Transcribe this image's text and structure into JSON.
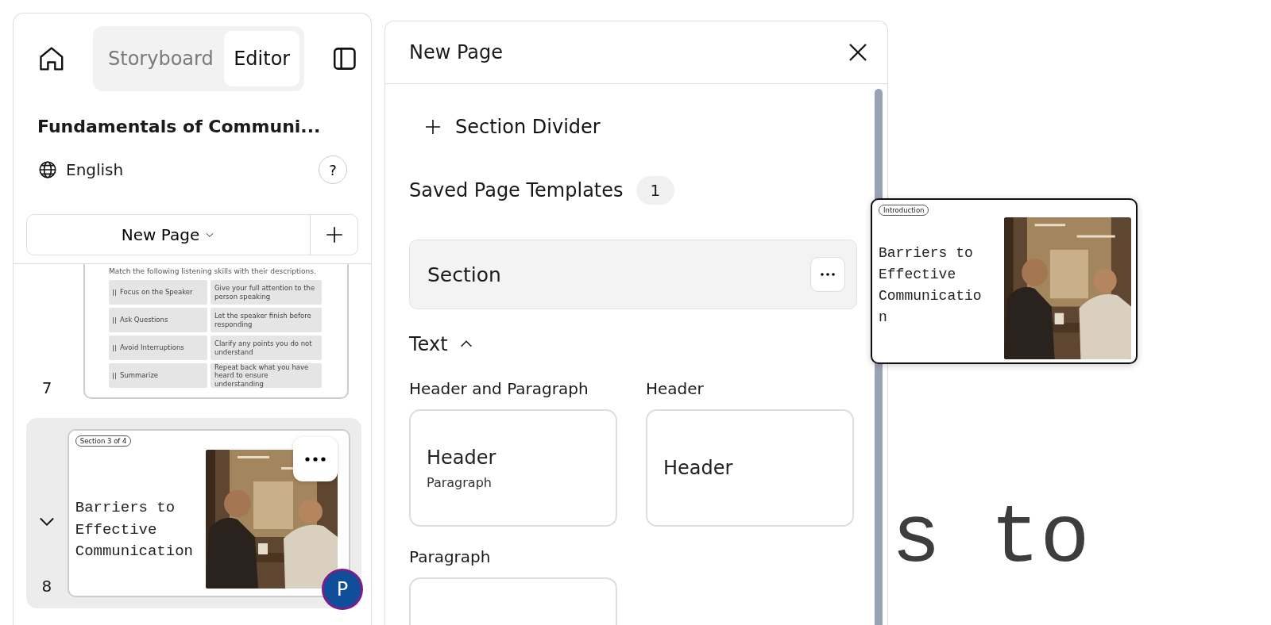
{
  "nav": {
    "tabs": [
      {
        "label": "Storyboard",
        "selected": false
      },
      {
        "label": "Editor",
        "selected": true
      }
    ]
  },
  "project": {
    "title": "Fundamentals of Communi...",
    "language": "English",
    "help": "?"
  },
  "new_page_button": {
    "label": "New Page"
  },
  "pages": [
    {
      "number": "7",
      "kind": "matching",
      "selected": false,
      "prompt": "Match the following listening skills with their descriptions.",
      "pairs": [
        [
          "Focus on the Speaker",
          "Give your full attention to the person speaking"
        ],
        [
          "Ask Questions",
          "Let the speaker finish before responding"
        ],
        [
          "Avoid Interruptions",
          "Clarify any points you do not understand"
        ],
        [
          "Summarize",
          "Repeat back what you have heard to ensure understanding"
        ]
      ]
    },
    {
      "number": "8",
      "kind": "title",
      "selected": true,
      "badge": "Section  3 of 4",
      "title": "Barriers to Effective Communication"
    }
  ],
  "avatar": {
    "initial": "P"
  },
  "new_page_panel": {
    "title": "New Page",
    "section_divider": "Section Divider",
    "saved_templates": {
      "label": "Saved Page Templates",
      "count": "1",
      "items": [
        {
          "name": "Section"
        }
      ]
    },
    "categories": [
      {
        "name": "Text",
        "expanded": true,
        "templates": [
          {
            "name": "Header and Paragraph",
            "preview_header": "Header",
            "preview_paragraph": "Paragraph"
          },
          {
            "name": "Header",
            "preview_header": "Header"
          },
          {
            "name": "Paragraph"
          }
        ]
      }
    ]
  },
  "drag_preview": {
    "badge": "Introduction",
    "title": "Barriers to Effective Communication"
  },
  "canvas": {
    "title_fragment": "s to"
  }
}
